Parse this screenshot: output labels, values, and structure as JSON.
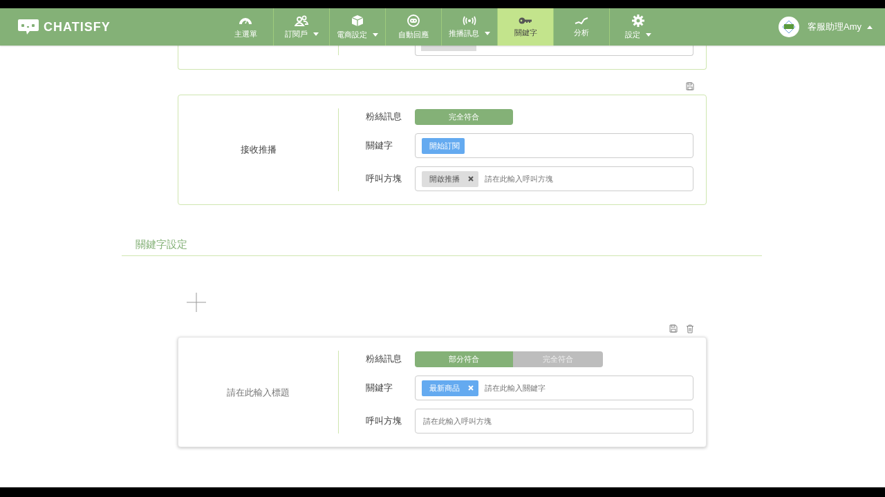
{
  "nav": {
    "logo": "CHATISFY",
    "items": [
      {
        "label": "主選單",
        "dropdown": false,
        "selected": false
      },
      {
        "label": "訂閱戶",
        "dropdown": true,
        "selected": false
      },
      {
        "label": "電商設定",
        "dropdown": true,
        "selected": false
      },
      {
        "label": "自動回應",
        "dropdown": false,
        "selected": false
      },
      {
        "label": "推播訊息",
        "dropdown": true,
        "selected": false
      },
      {
        "label": "關鍵字",
        "dropdown": false,
        "selected": true
      },
      {
        "label": "分析",
        "dropdown": false,
        "selected": false
      },
      {
        "label": "設定",
        "dropdown": true,
        "selected": false
      }
    ],
    "user": {
      "name": "客服助理Amy"
    }
  },
  "top_rules": [
    {
      "title": "接收推播",
      "editing": false,
      "deletable": false,
      "fields": [
        {
          "kind": "match",
          "label": "粉絲訊息",
          "options": [
            {
              "label": "完全符合",
              "selected": true
            }
          ]
        },
        {
          "kind": "keywords",
          "label": "關鍵字",
          "chips": [
            {
              "label": "開始訂閱",
              "removable": false
            }
          ]
        },
        {
          "kind": "blocks",
          "label": "呼叫方塊",
          "chips": [
            {
              "label": "開啟推播",
              "removable": true
            }
          ],
          "placeholder": "請在此輸入呼叫方塊"
        }
      ]
    }
  ],
  "section_title": "關鍵字設定",
  "rules": [
    {
      "title_placeholder": "請在此輸入標題",
      "editing": true,
      "deletable": true,
      "fields": [
        {
          "kind": "match",
          "label": "粉絲訊息",
          "options": [
            {
              "label": "部分符合",
              "selected": true
            },
            {
              "label": "完全符合",
              "selected": false
            }
          ]
        },
        {
          "kind": "keywords",
          "label": "關鍵字",
          "chips": [
            {
              "label": "最新商品",
              "removable": true
            }
          ],
          "placeholder": "請在此輸入關鍵字"
        },
        {
          "kind": "blocks",
          "label": "呼叫方塊",
          "placeholder": "請在此輸入呼叫方塊"
        }
      ]
    }
  ]
}
